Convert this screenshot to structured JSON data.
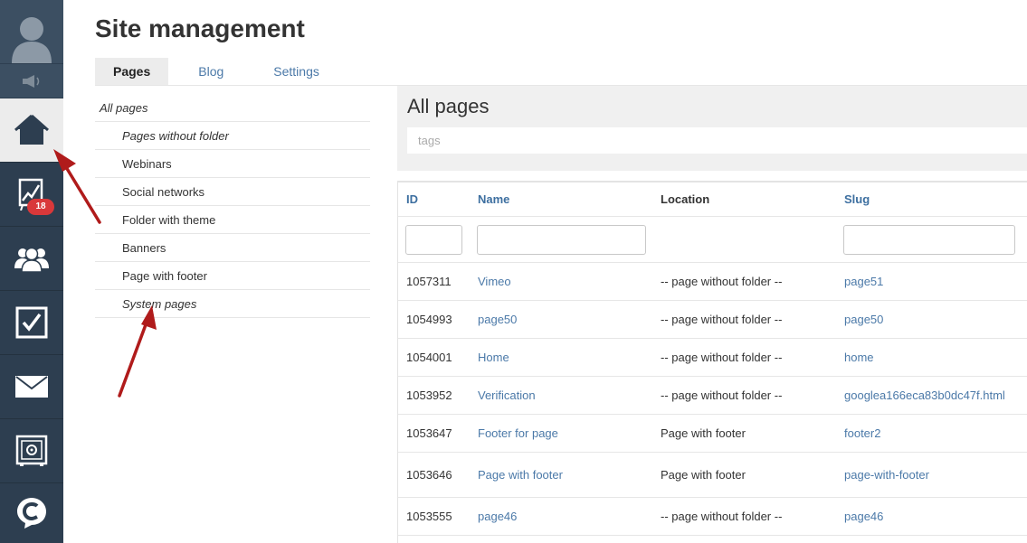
{
  "sidebar": {
    "badge_count": "18",
    "items": [
      {
        "name": "user-avatar",
        "icon": "user-silhouette-icon"
      },
      {
        "name": "notifications",
        "icon": "megaphone-icon"
      },
      {
        "name": "home",
        "icon": "home-icon",
        "active": true
      },
      {
        "name": "analytics",
        "icon": "chart-icon"
      },
      {
        "name": "users",
        "icon": "users-group-icon"
      },
      {
        "name": "tasks",
        "icon": "checkbox-icon"
      },
      {
        "name": "mail",
        "icon": "envelope-icon"
      },
      {
        "name": "safe",
        "icon": "safe-icon"
      },
      {
        "name": "brand",
        "icon": "c-logo-icon"
      }
    ]
  },
  "header": {
    "title": "Site management",
    "tabs": [
      {
        "label": "Pages",
        "active": true
      },
      {
        "label": "Blog",
        "active": false
      },
      {
        "label": "Settings",
        "active": false
      }
    ]
  },
  "folders": [
    {
      "label": "All pages"
    },
    {
      "label": "Pages without folder"
    },
    {
      "label": "Webinars"
    },
    {
      "label": "Social networks"
    },
    {
      "label": "Folder with theme"
    },
    {
      "label": "Banners"
    },
    {
      "label": "Page with footer"
    },
    {
      "label": "System pages"
    }
  ],
  "main": {
    "title": "All pages",
    "tags_placeholder": "tags",
    "columns": [
      "ID",
      "Name",
      "Location",
      "Slug"
    ],
    "rows": [
      {
        "id": "1057311",
        "name": "Vimeo",
        "location": "-- page without folder --",
        "slug": "page51"
      },
      {
        "id": "1054993",
        "name": "page50",
        "location": "-- page without folder --",
        "slug": "page50"
      },
      {
        "id": "1054001",
        "name": "Home",
        "location": "-- page without folder --",
        "slug": "home"
      },
      {
        "id": "1053952",
        "name": "Verification",
        "location": "-- page without folder --",
        "slug": "googlea166eca83b0dc47f.html"
      },
      {
        "id": "1053647",
        "name": "Footer for page",
        "location": "Page with footer",
        "slug": "footer2"
      },
      {
        "id": "1053646",
        "name": "Page with footer",
        "location": "Page with footer",
        "slug": "page-with-footer"
      },
      {
        "id": "1053555",
        "name": "page46",
        "location": "-- page without folder --",
        "slug": "page46"
      }
    ]
  },
  "colors": {
    "rail": "#2d3e50",
    "link": "#4b79a8",
    "badge": "#d9383a",
    "arrow": "#b01b1b"
  }
}
